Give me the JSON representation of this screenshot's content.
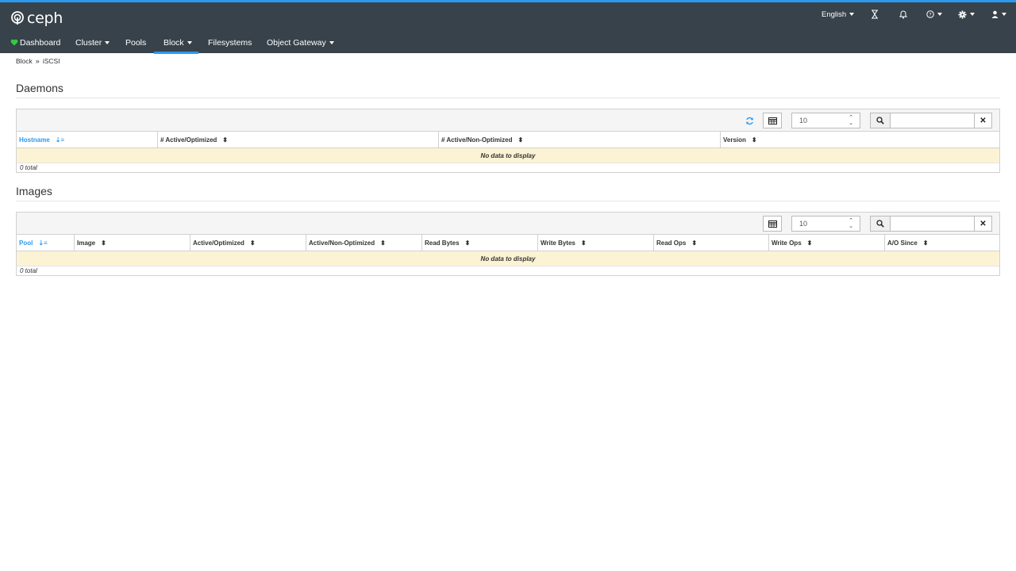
{
  "brand": {
    "name": "ceph"
  },
  "header_utils": {
    "language": "English",
    "tasks_icon": "hourglass-icon",
    "notifications_icon": "bell-icon",
    "help_icon": "question-circle-icon",
    "settings_icon": "gear-icon",
    "user_icon": "user-icon"
  },
  "nav": {
    "items": [
      {
        "label": "Dashboard"
      },
      {
        "label": "Cluster"
      },
      {
        "label": "Pools"
      },
      {
        "label": "Block"
      },
      {
        "label": "Filesystems"
      },
      {
        "label": "Object Gateway"
      }
    ]
  },
  "breadcrumb": {
    "parent": "Block",
    "current": "iSCSI"
  },
  "daemons": {
    "title": "Daemons",
    "limit": "10",
    "columns": [
      "Hostname",
      "# Active/Optimized",
      "# Active/Non-Optimized",
      "Version"
    ],
    "empty_text": "No data to display",
    "total": "0 total"
  },
  "images": {
    "title": "Images",
    "limit": "10",
    "columns": [
      "Pool",
      "Image",
      "Active/Optimized",
      "Active/Non-Optimized",
      "Read Bytes",
      "Write Bytes",
      "Read Ops",
      "Write Ops",
      "A/O Since"
    ],
    "empty_text": "No data to display",
    "total": "0 total"
  },
  "colors": {
    "navbar": "#37424a",
    "accent": "#2b99f0",
    "empty_row": "#fcf3d4",
    "dashboard_heart": "#2ecc40"
  }
}
